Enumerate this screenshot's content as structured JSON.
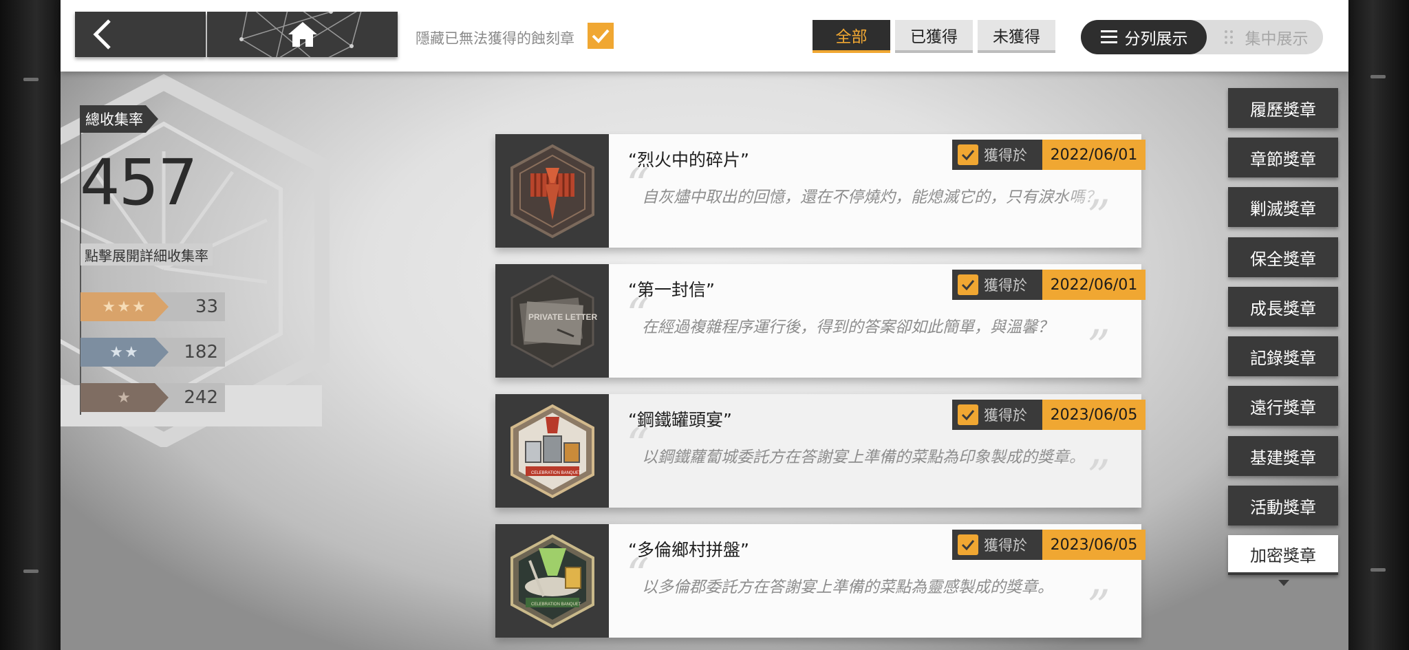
{
  "topbar": {
    "back_icon": "chevron-left-icon",
    "home_icon": "home-icon",
    "hide_unobtainable_label": "隱藏已無法獲得的蝕刻章",
    "hide_unobtainable_checked": true,
    "filter_tabs": [
      {
        "label": "全部",
        "active": true
      },
      {
        "label": "已獲得",
        "active": false
      },
      {
        "label": "未獲得",
        "active": false
      }
    ],
    "view_modes": [
      {
        "label": "分列展示",
        "icon": "list-icon",
        "active": true
      },
      {
        "label": "集中展示",
        "icon": "grid-icon",
        "active": false
      }
    ]
  },
  "stats": {
    "title": "總收集率",
    "total": "457",
    "detail_link": "點擊展開詳細收集率",
    "tiers": [
      {
        "stars": "★★★",
        "count": "33",
        "color": "#d9a36a"
      },
      {
        "stars": "★★",
        "count": "182",
        "color": "#7d8ea0"
      },
      {
        "stars": "★",
        "count": "242",
        "color": "#7f6d62"
      }
    ]
  },
  "medals": [
    {
      "name": "“烈火中的碎片”",
      "obtained_label": "獲得於",
      "date": "2022/06/01",
      "description": "自灰燼中取出的回憶，還在不停燒灼，能熄滅它的，只有淚水嗎？",
      "icon": "fire-fragment-medal-icon"
    },
    {
      "name": "“第一封信”",
      "obtained_label": "獲得於",
      "date": "2022/06/01",
      "description": "在經過複雜程序運行後，得到的答案卻如此簡單，與溫馨？",
      "icon": "private-letter-medal-icon",
      "badge_text": "PRIVATE LETTER"
    },
    {
      "name": "“鋼鐵罐頭宴”",
      "obtained_label": "獲得於",
      "date": "2023/06/05",
      "description": "以鋼鐵蘿蔔城委託方在答謝宴上準備的菜點為印象製成的獎章。",
      "icon": "celebration-banquet-medal-icon",
      "badge_text": "CELEBRATION BANQUET"
    },
    {
      "name": "“多倫鄉村拼盤”",
      "obtained_label": "獲得於",
      "date": "2023/06/05",
      "description": "以多倫郡委託方在答謝宴上準備的菜點為靈感製成的獎章。",
      "icon": "celebration-banquet-platter-medal-icon",
      "badge_text": "CELEBRATION BANQUET"
    }
  ],
  "categories": [
    {
      "label": "履歷獎章",
      "active": false
    },
    {
      "label": "章節獎章",
      "active": false
    },
    {
      "label": "剿滅獎章",
      "active": false
    },
    {
      "label": "保全獎章",
      "active": false
    },
    {
      "label": "成長獎章",
      "active": false
    },
    {
      "label": "記錄獎章",
      "active": false
    },
    {
      "label": "遠行獎章",
      "active": false
    },
    {
      "label": "基建獎章",
      "active": false
    },
    {
      "label": "活動獎章",
      "active": false
    },
    {
      "label": "加密獎章",
      "active": true
    }
  ],
  "colors": {
    "accent": "#f0a732",
    "dark_panel": "#3a3a3a",
    "card_bg": "#fbfbfb"
  }
}
